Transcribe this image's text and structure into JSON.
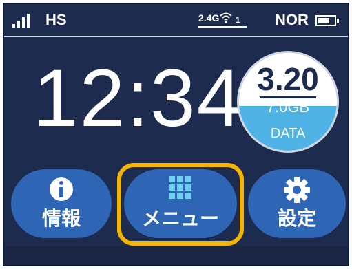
{
  "status": {
    "network": "HS",
    "band": "2.4G",
    "wifi_clients": "1",
    "mode": "NOR",
    "battery_level": 0.75,
    "signal_bars": 3
  },
  "clock": {
    "time": "12:34"
  },
  "data_usage": {
    "used": "3.20",
    "capacity": "7.0GB",
    "label": "DATA",
    "fill_ratio": 0.46,
    "fill_color": "#4fb3e6"
  },
  "buttons": [
    {
      "label": "情報",
      "icon": "info-icon"
    },
    {
      "label": "メニュー",
      "icon": "grid-icon"
    },
    {
      "label": "設定",
      "icon": "gear-icon"
    }
  ],
  "colors": {
    "background": "#1d2b4e",
    "button": "#2e65b5",
    "highlight": "#f5b400"
  }
}
